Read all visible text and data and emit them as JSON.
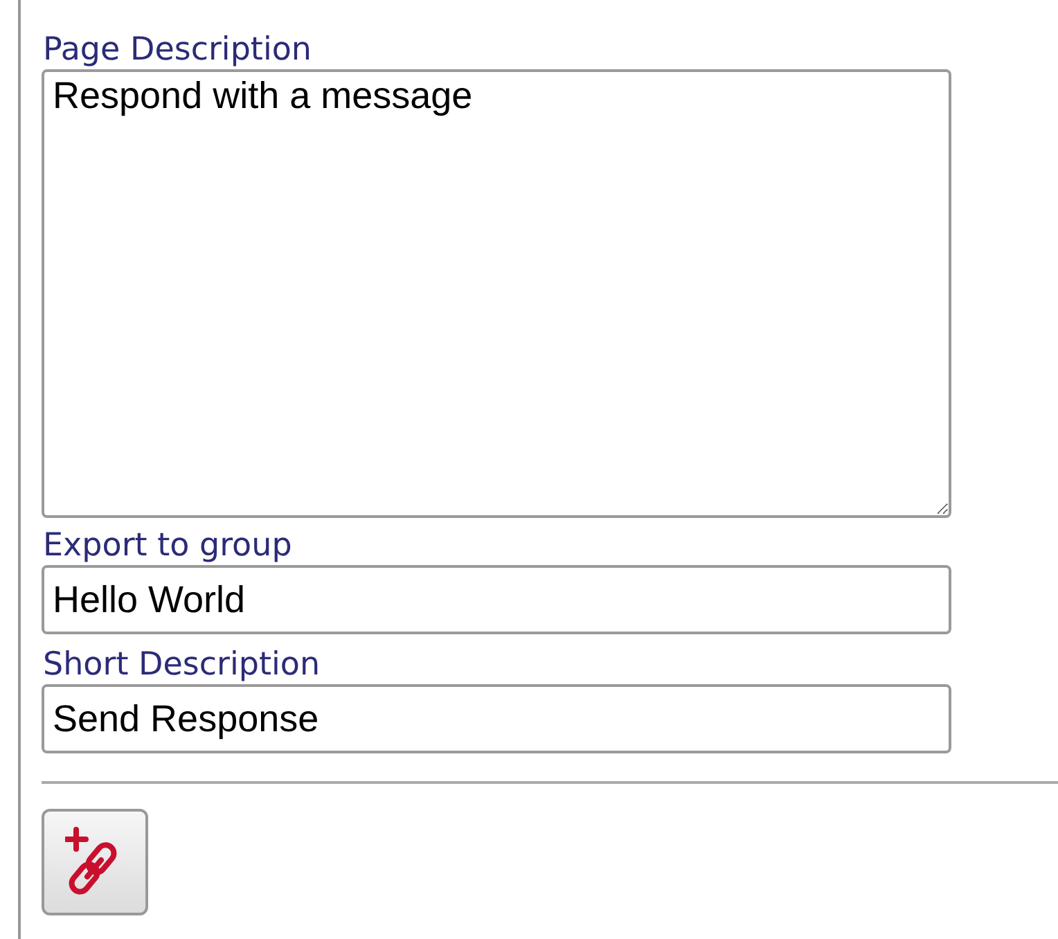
{
  "fields": [
    {
      "kind": "textarea",
      "label": "Page Description",
      "value": "Respond with a message"
    },
    {
      "kind": "text",
      "label": "Export to group",
      "value": "Hello World"
    },
    {
      "kind": "text",
      "label": "Short Description",
      "value": "Send Response"
    }
  ],
  "toolbar": [
    {
      "kind": "add-link"
    }
  ]
}
